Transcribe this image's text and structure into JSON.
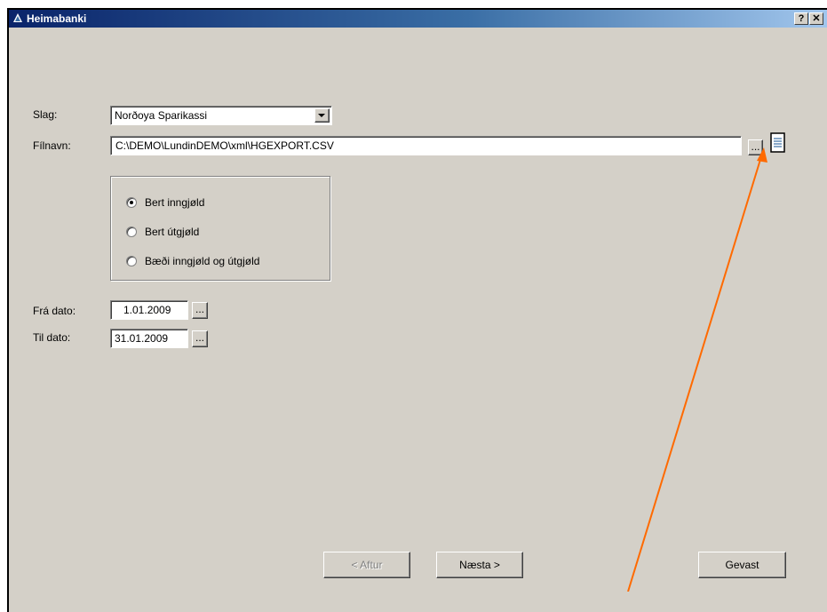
{
  "window": {
    "title": "Heimabanki",
    "help_label": "?",
    "close_label": "✕"
  },
  "form": {
    "slag_label": "Slag:",
    "slag_value": "Norðoya Sparikassi",
    "filnavn_label": "Fílnavn:",
    "filnavn_value": "C:\\DEMO\\LundinDEMO\\xml\\HGEXPORT.CSV",
    "browse_label": "...",
    "radios": [
      {
        "label": "Bert inngjøld",
        "checked": true
      },
      {
        "label": "Bert útgjøld",
        "checked": false
      },
      {
        "label": "Bæði inngjøld og útgjøld",
        "checked": false
      }
    ],
    "fra_label": "Frá dato:",
    "fra_value": "1.01.2009",
    "til_label": "Til dato:",
    "til_value": "31.01.2009",
    "date_btn_label": "..."
  },
  "buttons": {
    "back": "< Aftur",
    "next": "Næsta >",
    "cancel": "Gevast"
  },
  "colors": {
    "annotation_arrow": "#ff6a00"
  }
}
